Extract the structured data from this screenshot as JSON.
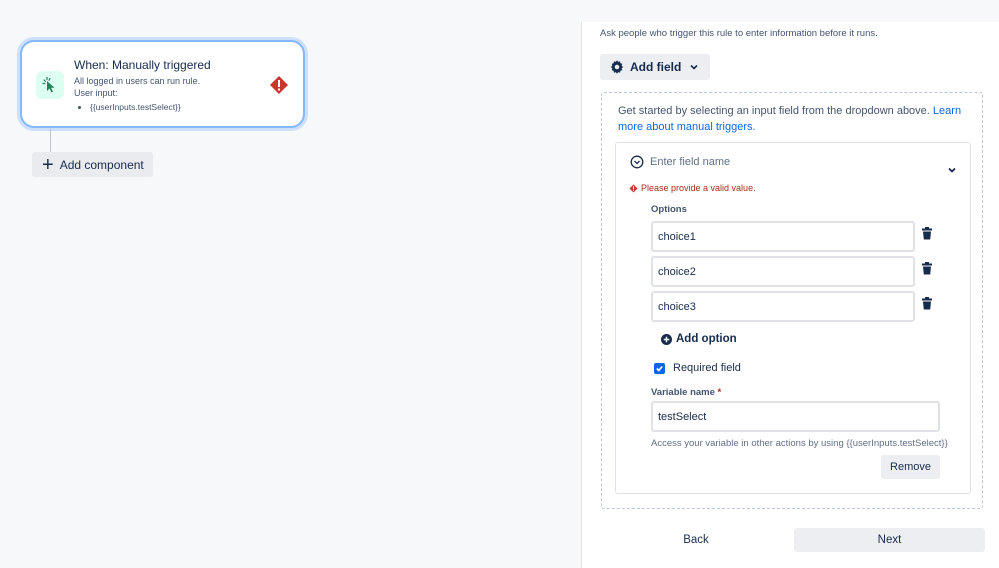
{
  "trigger": {
    "title": "When: Manually triggered",
    "permission": "All logged in users can run rule.",
    "user_input_label": "User input:",
    "inputs": [
      "{{userInputs.testSelect}}"
    ]
  },
  "canvas": {
    "add_component_label": "Add component"
  },
  "panel": {
    "intro": "Ask people who trigger this rule to enter information before it runs.",
    "add_field_label": "Add field",
    "help_text": "Get started by selecting an input field from the dropdown above.",
    "help_link": "Learn more about manual triggers.",
    "field": {
      "name_placeholder": "Enter field name",
      "error": "Please provide a valid value.",
      "options_label": "Options",
      "options": [
        "choice1",
        "choice2",
        "choice3"
      ],
      "add_option_label": "Add option",
      "required_label": "Required field",
      "required_checked": true,
      "variable_label": "Variable name",
      "variable_required_mark": "*",
      "variable_value": "testSelect",
      "variable_help": "Access your variable in other actions by using {{userInputs.testSelect}}",
      "remove_label": "Remove"
    },
    "back_label": "Back",
    "next_label": "Next"
  },
  "colors": {
    "accent": "#0c66e4",
    "error": "#ae2a19",
    "trigger_icon_bg": "#dcfff1",
    "trigger_icon": "#1f845a",
    "card_border": "#85b8ff"
  },
  "icons": {
    "trigger": "cursor-click-icon",
    "error": "warning-diamond-icon",
    "add_field": "gear-icon",
    "trash": "trash-icon",
    "add_option": "plus-circle-icon"
  }
}
